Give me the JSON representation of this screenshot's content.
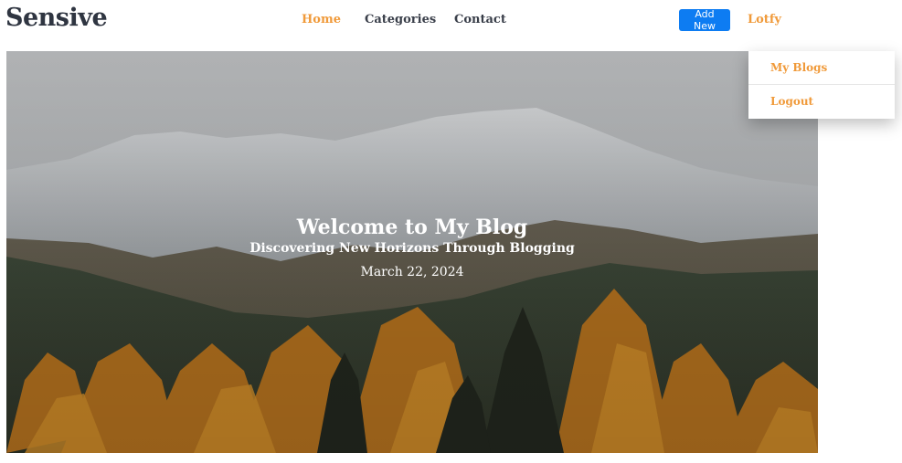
{
  "brand": "Sensive",
  "nav": {
    "home": "Home",
    "categories": "Categories",
    "contact": "Contact"
  },
  "actions": {
    "add_new": "Add New",
    "user": "Lotfy"
  },
  "dropdown": {
    "my_blogs": "My Blogs",
    "logout": "Logout"
  },
  "hero": {
    "title": "Welcome to My Blog",
    "subtitle": "Discovering New Horizons Through Blogging",
    "date": "March 22, 2024"
  },
  "colors": {
    "accent": "#f09a3a",
    "primary_button": "#0d7cf2",
    "brand_text": "#2f3541"
  }
}
